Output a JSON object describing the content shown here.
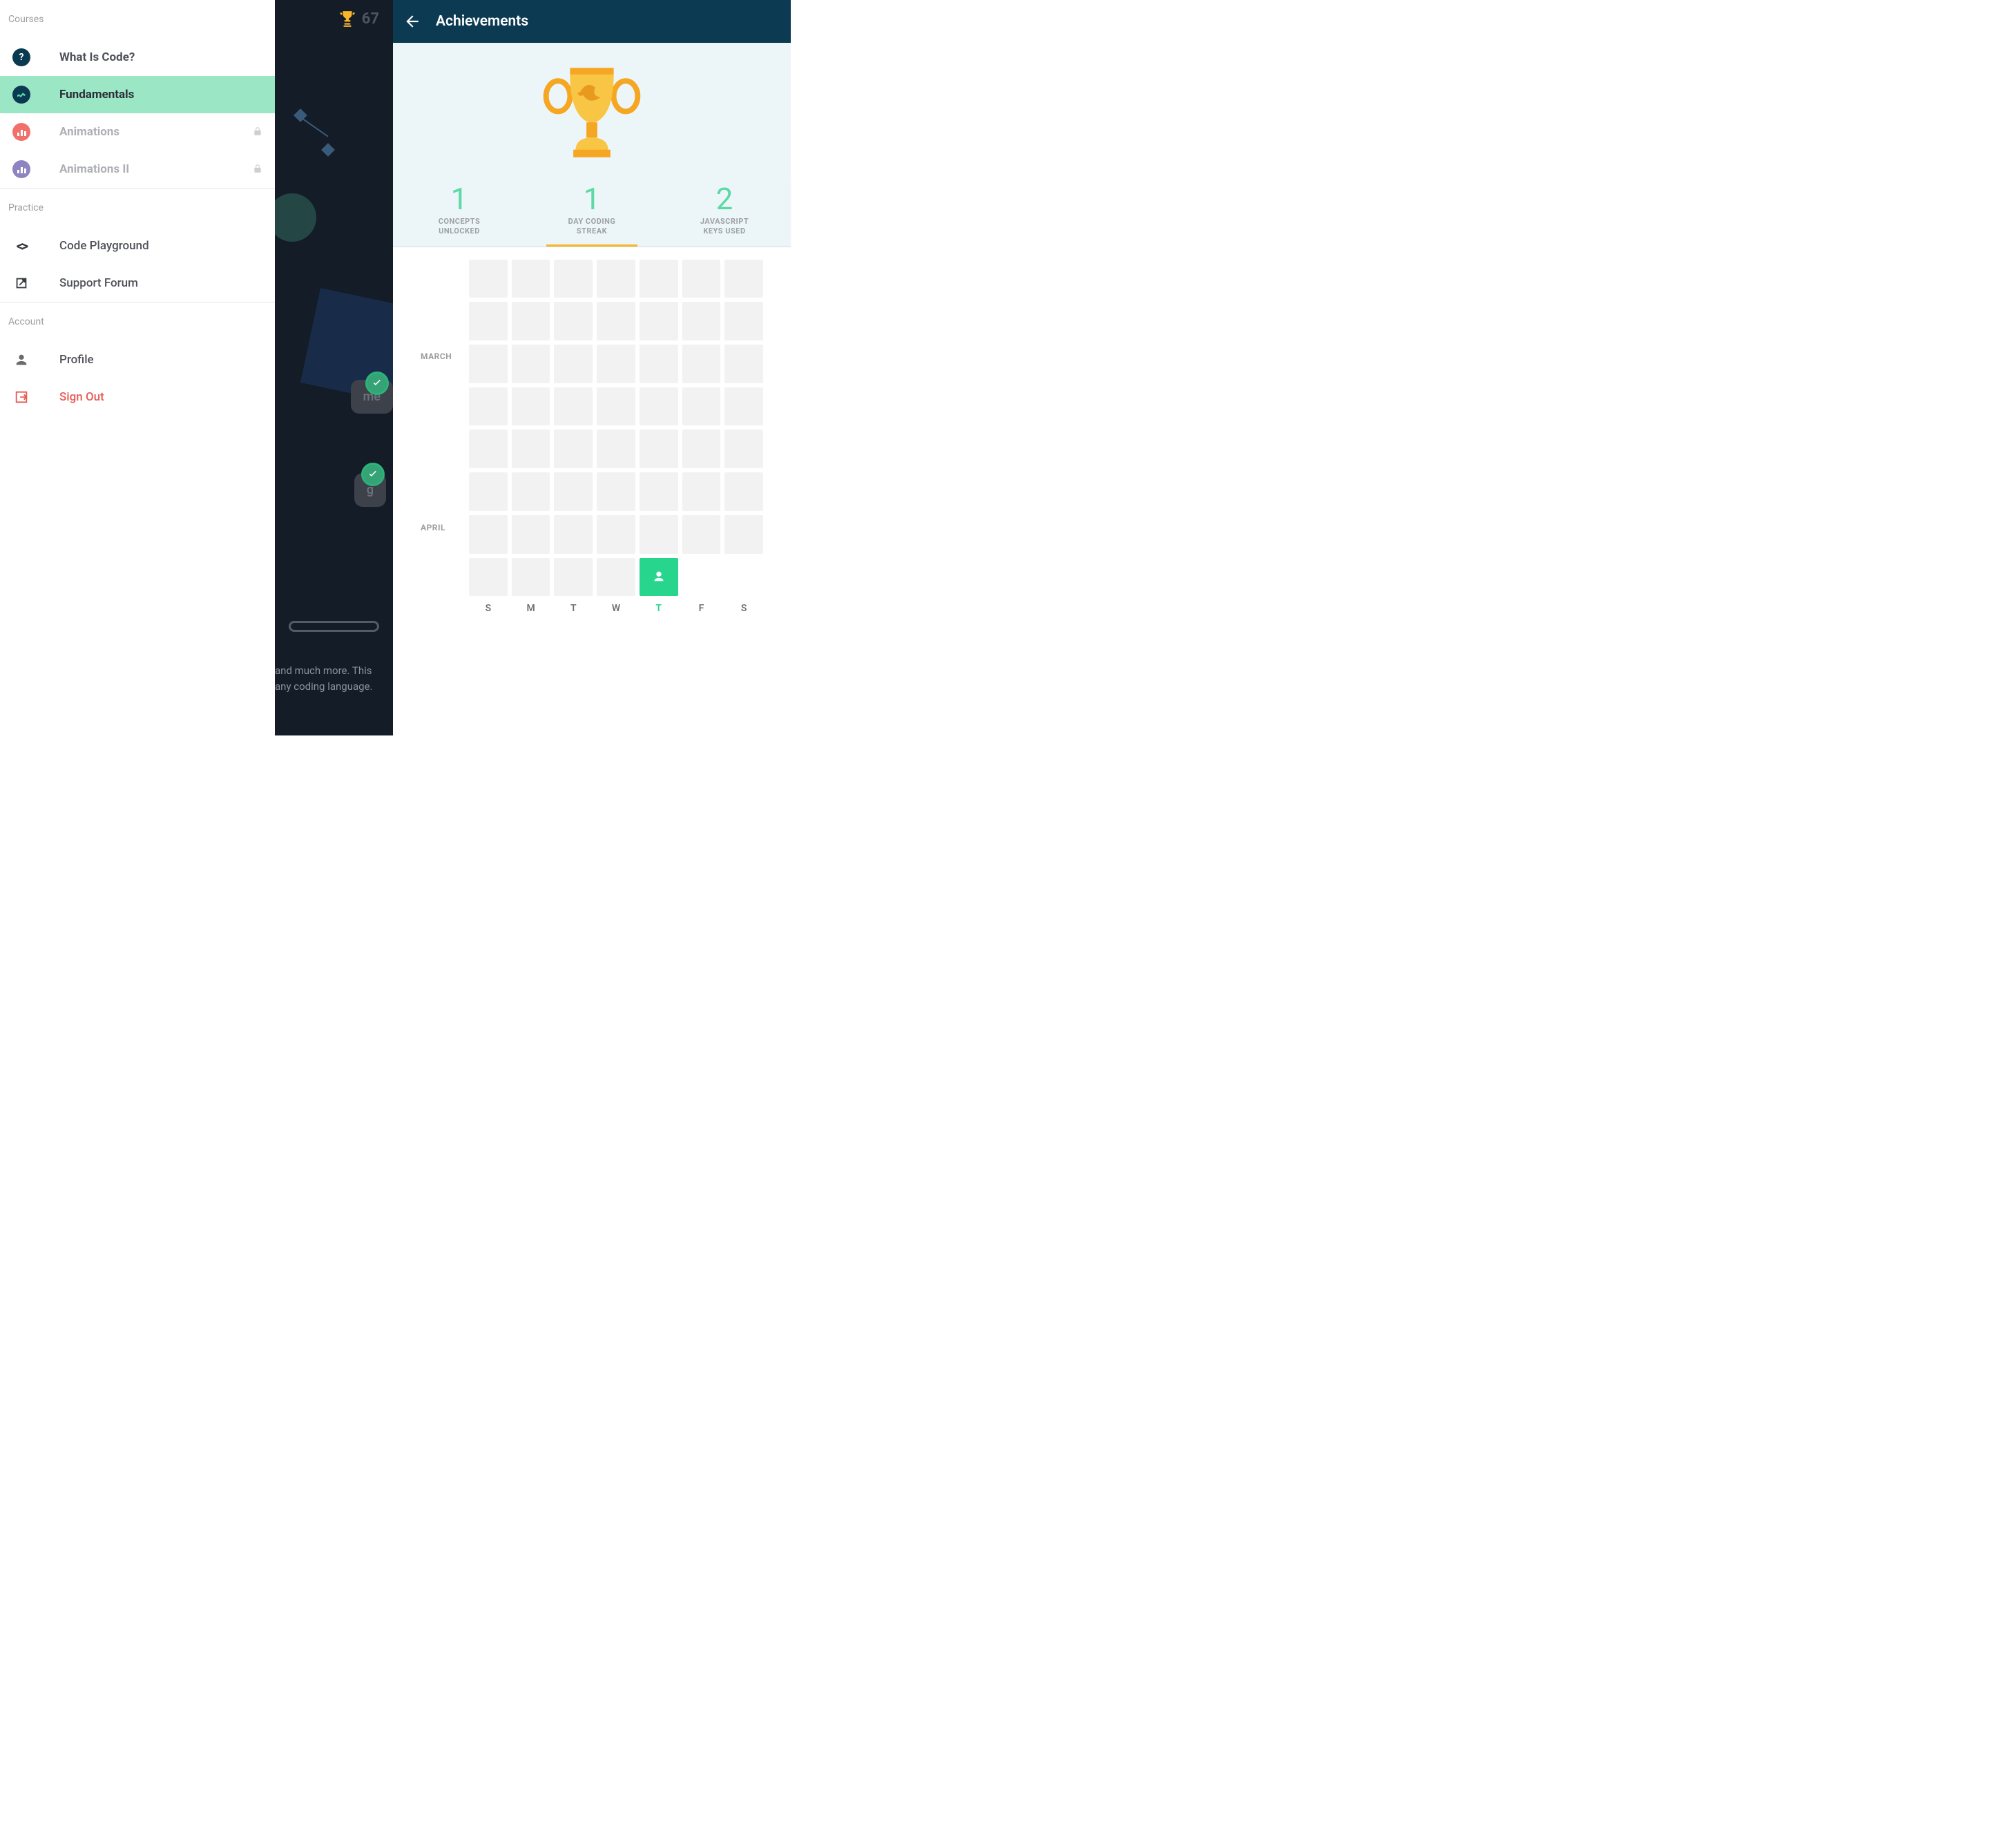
{
  "sidebar": {
    "sections": {
      "courses_label": "Courses",
      "practice_label": "Practice",
      "account_label": "Account"
    },
    "courses": [
      {
        "label": "What Is Code?",
        "locked": false
      },
      {
        "label": "Fundamentals",
        "locked": false
      },
      {
        "label": "Animations",
        "locked": true
      },
      {
        "label": "Animations II",
        "locked": true
      }
    ],
    "practice": [
      {
        "label": "Code Playground"
      },
      {
        "label": "Support Forum"
      }
    ],
    "account": [
      {
        "label": "Profile"
      },
      {
        "label": "Sign Out"
      }
    ]
  },
  "middle": {
    "score": "67",
    "node1": "me",
    "node2": "g",
    "desc_line1": "and much more. This",
    "desc_line2": "any coding language."
  },
  "right": {
    "title": "Achievements",
    "stats": [
      {
        "num": "1",
        "label1": "CONCEPTS",
        "label2": "UNLOCKED"
      },
      {
        "num": "1",
        "label1": "DAY CODING",
        "label2": "STREAK"
      },
      {
        "num": "2",
        "label1": "JAVASCRIPT",
        "label2": "KEYS USED"
      }
    ],
    "months": {
      "march": "MARCH",
      "april": "APRIL"
    },
    "days": [
      "S",
      "M",
      "T",
      "W",
      "T",
      "F",
      "S"
    ],
    "highlight_day_index": 4
  }
}
